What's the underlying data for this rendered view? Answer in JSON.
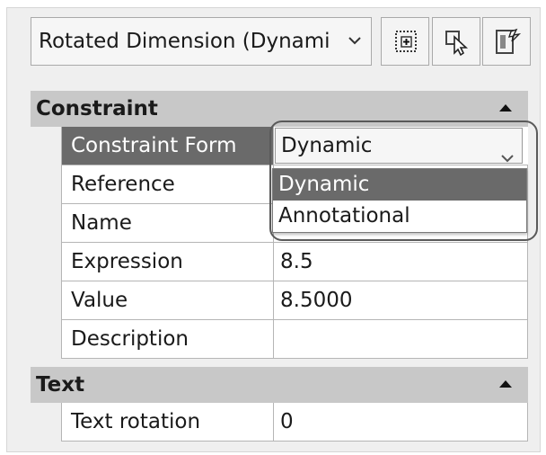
{
  "selector": {
    "value": "Rotated Dimension (Dynami"
  },
  "toolbar": {
    "buttons": [
      {
        "icon": "add-to-selection-icon"
      },
      {
        "icon": "select-objects-icon"
      },
      {
        "icon": "quick-select-icon"
      }
    ]
  },
  "sections": {
    "constraint": {
      "title": "Constraint",
      "rows": {
        "constraint_form": {
          "label": "Constraint Form",
          "value": "Dynamic"
        },
        "reference": {
          "label": "Reference",
          "value": ""
        },
        "name": {
          "label": "Name",
          "value": ""
        },
        "expression": {
          "label": "Expression",
          "value": "8.5"
        },
        "value": {
          "label": "Value",
          "value": "8.5000"
        },
        "description": {
          "label": "Description",
          "value": ""
        }
      }
    },
    "text": {
      "title": "Text",
      "rows": {
        "text_rotation": {
          "label": "Text rotation",
          "value": "0"
        }
      }
    }
  },
  "dropdown": {
    "options": [
      "Dynamic",
      "Annotational"
    ],
    "highlighted": "Dynamic"
  },
  "colors": {
    "section_header": "#c8c8c8",
    "selected_row": "#6a6a6a",
    "panel_bg": "#efefef"
  }
}
